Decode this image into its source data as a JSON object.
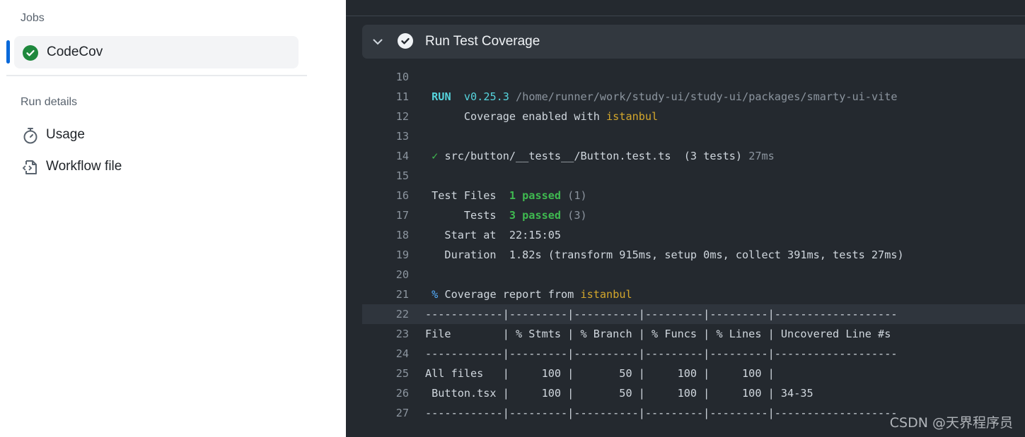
{
  "sidebar": {
    "jobs_title": "Jobs",
    "job": {
      "label": "CodeCov",
      "status": "success",
      "icon": "check-circle-fill-icon"
    },
    "run_details_title": "Run details",
    "items": [
      {
        "label": "Usage",
        "icon": "stopwatch-icon"
      },
      {
        "label": "Workflow file",
        "icon": "file-code-icon"
      }
    ]
  },
  "step": {
    "title": "Run Test Coverage",
    "status": "success"
  },
  "colors": {
    "default": "#d0d7de",
    "cyan": "#56d4dd",
    "dim": "#8c959f",
    "yellow": "#d4a72c",
    "green": "#3fb950",
    "blue": "#54aeff",
    "accent": "#0969da",
    "success": "#1f883d"
  },
  "log": [
    {
      "n": "10",
      "segs": []
    },
    {
      "n": "11",
      "segs": [
        {
          "t": " "
        },
        {
          "t": "RUN",
          "c": "cyan",
          "b": true
        },
        {
          "t": "  "
        },
        {
          "t": "v0.25.3",
          "c": "cyan"
        },
        {
          "t": " /home/runner/work/study-ui/study-ui/packages/smarty-ui-vite",
          "c": "dim"
        }
      ]
    },
    {
      "n": "12",
      "segs": [
        {
          "t": "      Coverage enabled with "
        },
        {
          "t": "istanbul",
          "c": "yellow"
        }
      ]
    },
    {
      "n": "13",
      "segs": []
    },
    {
      "n": "14",
      "segs": [
        {
          "t": " "
        },
        {
          "t": "✓",
          "c": "green"
        },
        {
          "t": " src/button/__tests__/Button.test.ts  (3 tests) "
        },
        {
          "t": "27ms",
          "c": "dim"
        }
      ]
    },
    {
      "n": "15",
      "segs": []
    },
    {
      "n": "16",
      "segs": [
        {
          "t": " Test Files  "
        },
        {
          "t": "1 passed",
          "c": "green",
          "b": true
        },
        {
          "t": " (1)",
          "c": "dim"
        }
      ]
    },
    {
      "n": "17",
      "segs": [
        {
          "t": "      Tests  "
        },
        {
          "t": "3 passed",
          "c": "green",
          "b": true
        },
        {
          "t": " (3)",
          "c": "dim"
        }
      ]
    },
    {
      "n": "18",
      "segs": [
        {
          "t": "   Start at  22:15:05"
        }
      ]
    },
    {
      "n": "19",
      "segs": [
        {
          "t": "   Duration  1.82s (transform 915ms, setup 0ms, collect 391ms, tests 27ms)"
        }
      ]
    },
    {
      "n": "20",
      "segs": []
    },
    {
      "n": "21",
      "segs": [
        {
          "t": " "
        },
        {
          "t": "%",
          "c": "blue"
        },
        {
          "t": " Coverage report from "
        },
        {
          "t": "istanbul",
          "c": "yellow"
        }
      ]
    },
    {
      "n": "22",
      "hl": true,
      "segs": [
        {
          "t": "------------|---------|----------|---------|---------|-------------------"
        }
      ]
    },
    {
      "n": "23",
      "segs": [
        {
          "t": "File        | % Stmts | % Branch | % Funcs | % Lines | Uncovered Line #s"
        }
      ]
    },
    {
      "n": "24",
      "segs": [
        {
          "t": "------------|---------|----------|---------|---------|-------------------"
        }
      ]
    },
    {
      "n": "25",
      "segs": [
        {
          "t": "All files   |     100 |       50 |     100 |     100 |"
        }
      ]
    },
    {
      "n": "26",
      "segs": [
        {
          "t": " Button.tsx |     100 |       50 |     100 |     100 | 34-35"
        }
      ]
    },
    {
      "n": "27",
      "segs": [
        {
          "t": "------------|---------|----------|---------|---------|-------------------"
        }
      ]
    }
  ],
  "watermark": "CSDN @天界程序员"
}
